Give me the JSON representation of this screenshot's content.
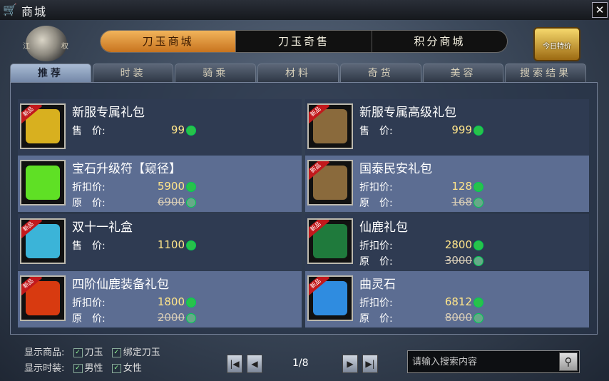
{
  "window": {
    "title": "商城",
    "close": "✕"
  },
  "emblem": {
    "left": "江",
    "right": "权"
  },
  "main_tabs": [
    "刀玉商城",
    "刀玉奇售",
    "积分商城"
  ],
  "chest": {
    "label": "今日特价"
  },
  "sub_tabs": [
    "推荐",
    "时装",
    "骑乘",
    "材料",
    "奇货",
    "美容",
    "搜索结果"
  ],
  "items": [
    {
      "name": "新服专属礼包",
      "tag": "新品",
      "price_label": "售　价:",
      "price": "99",
      "art": "#d8b01f"
    },
    {
      "name": "新服专属高级礼包",
      "tag": "新品",
      "price_label": "售　价:",
      "price": "999",
      "art": "#8a6a3c"
    },
    {
      "name": "宝石升级符【窥径】",
      "tag": "",
      "price_label": "折扣价:",
      "price": "5900",
      "orig_label": "原　价:",
      "orig": "6900",
      "art": "#5fe025"
    },
    {
      "name": "国泰民安礼包",
      "tag": "新品",
      "price_label": "折扣价:",
      "price": "128",
      "orig_label": "原　价:",
      "orig": "168",
      "art": "#8a6a3c"
    },
    {
      "name": "双十一礼盒",
      "tag": "新品",
      "price_label": "售　价:",
      "price": "1100",
      "art": "#3bb4d8"
    },
    {
      "name": "仙鹿礼包",
      "tag": "新品",
      "price_label": "折扣价:",
      "price": "2800",
      "orig_label": "原　价:",
      "orig": "3000",
      "art": "#1f7a3c"
    },
    {
      "name": "四阶仙鹿装备礼包",
      "tag": "新品",
      "price_label": "折扣价:",
      "price": "1800",
      "orig_label": "原　价:",
      "orig": "2000",
      "art": "#d83a10"
    },
    {
      "name": "曲灵石",
      "tag": "新品",
      "price_label": "折扣价:",
      "price": "6812",
      "orig_label": "原　价:",
      "orig": "8000",
      "art": "#2f8ce0"
    }
  ],
  "filters": {
    "goods_label": "显示商品:",
    "goods_opts": [
      "刀玉",
      "绑定刀玉"
    ],
    "fashion_label": "显示时装:",
    "fashion_opts": [
      "男性",
      "女性"
    ]
  },
  "pager": {
    "text": "1/8"
  },
  "search": {
    "placeholder": "请输入搜索内容"
  }
}
